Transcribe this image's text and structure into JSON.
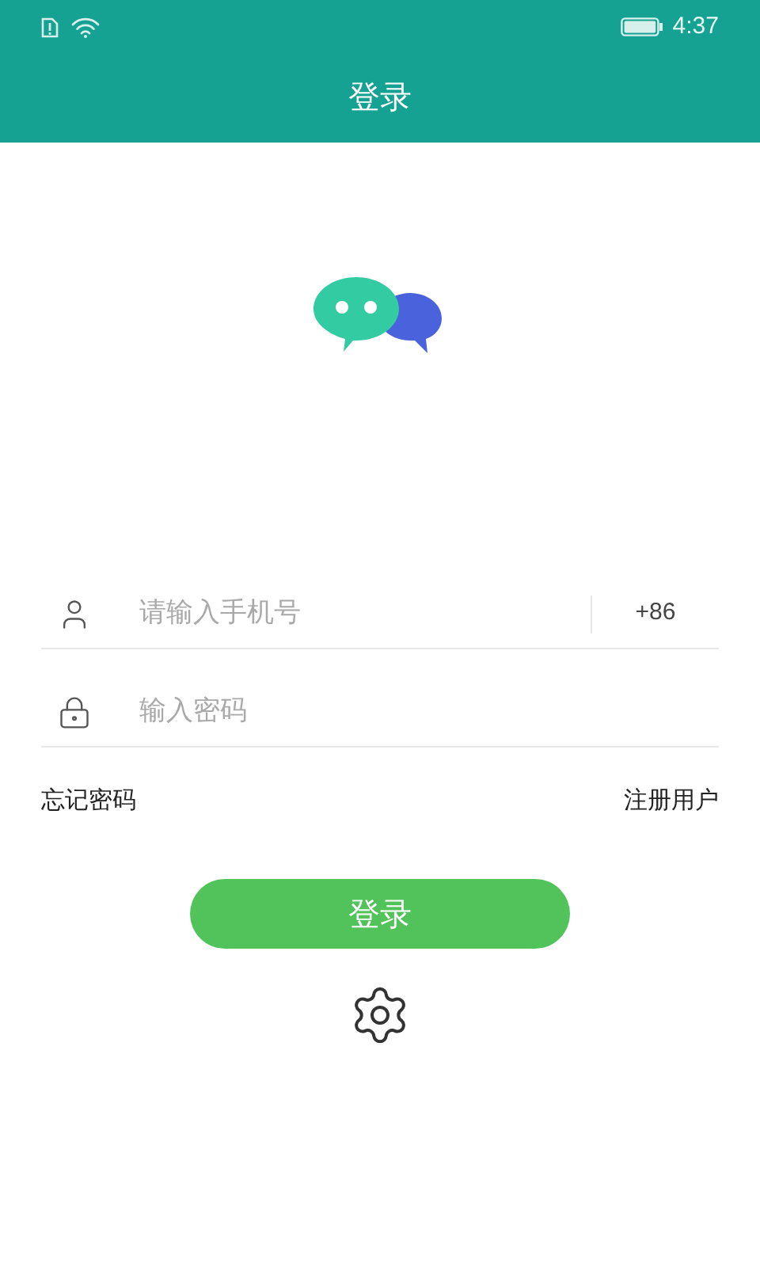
{
  "status_bar": {
    "time": "4:37"
  },
  "header": {
    "title": "登录"
  },
  "phone_field": {
    "placeholder": "请输入手机号",
    "country_code": "+86"
  },
  "password_field": {
    "placeholder": "输入密码"
  },
  "links": {
    "forgot": "忘记密码",
    "register": "注册用户"
  },
  "login_button": "登录"
}
